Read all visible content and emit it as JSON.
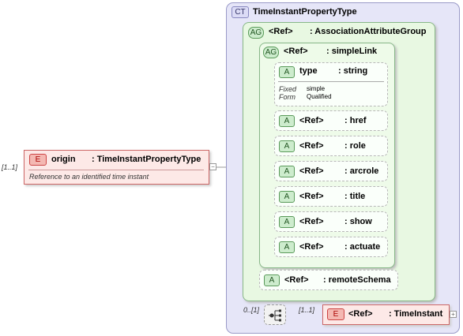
{
  "root_element": {
    "badge": "E",
    "name": "origin",
    "type": ": TimeInstantPropertyType",
    "cardinality": "[1..1]",
    "annotation": "Reference to an identified time instant"
  },
  "complex_type": {
    "badge": "CT",
    "name": "TimeInstantPropertyType"
  },
  "association_group": {
    "badge": "AG",
    "ref": "<Ref>",
    "name": ": AssociationAttributeGroup"
  },
  "simple_link_group": {
    "badge": "AG",
    "ref": "<Ref>",
    "name": ": simpleLink"
  },
  "type_attribute": {
    "badge": "A",
    "name": "type",
    "type": ": string",
    "fixed_label": "Fixed",
    "fixed_value": "simple",
    "form_label": "Form",
    "form_value": "Qualified"
  },
  "link_attributes": [
    {
      "badge": "A",
      "ref": "<Ref>",
      "name": ": href"
    },
    {
      "badge": "A",
      "ref": "<Ref>",
      "name": ": role"
    },
    {
      "badge": "A",
      "ref": "<Ref>",
      "name": ": arcrole"
    },
    {
      "badge": "A",
      "ref": "<Ref>",
      "name": ": title"
    },
    {
      "badge": "A",
      "ref": "<Ref>",
      "name": ": show"
    },
    {
      "badge": "A",
      "ref": "<Ref>",
      "name": ": actuate"
    }
  ],
  "remote_schema": {
    "badge": "A",
    "ref": "<Ref>",
    "name": ": remoteSchema"
  },
  "sequence": {
    "cardinality": "0..[1]",
    "icon": "sequence-icon"
  },
  "child_element": {
    "badge": "E",
    "ref": "<Ref>",
    "name": ": TimeInstant",
    "cardinality": "[1..1]"
  },
  "colors": {
    "element_fill": "#fde9e7",
    "element_border": "#c66",
    "ct_fill": "#e6e6f8",
    "ct_border": "#9a9ac8",
    "group_fill": "#e8f8e2",
    "group_border": "#88b888",
    "attr_border": "#b8b8b8"
  }
}
